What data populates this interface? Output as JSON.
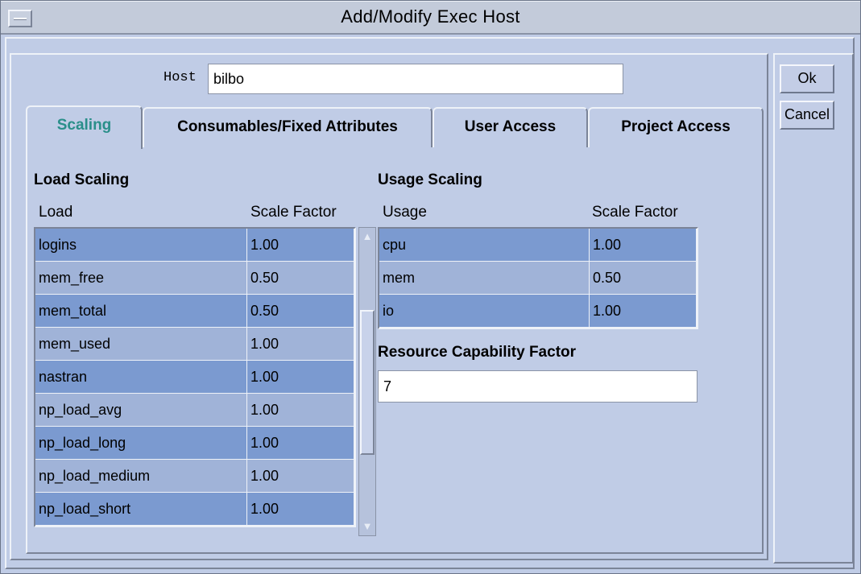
{
  "window": {
    "title": "Add/Modify Exec Host"
  },
  "host": {
    "label": "Host",
    "value": "bilbo"
  },
  "buttons": {
    "ok": "Ok",
    "cancel": "Cancel"
  },
  "tabs": [
    {
      "label": "Scaling",
      "active": true
    },
    {
      "label": "Consumables/Fixed Attributes",
      "active": false
    },
    {
      "label": "User Access",
      "active": false
    },
    {
      "label": "Project Access",
      "active": false
    }
  ],
  "load_scaling": {
    "title": "Load Scaling",
    "col_load": "Load",
    "col_factor": "Scale Factor",
    "rows": [
      {
        "load": "logins",
        "factor": "1.00"
      },
      {
        "load": "mem_free",
        "factor": "0.50"
      },
      {
        "load": "mem_total",
        "factor": "0.50"
      },
      {
        "load": "mem_used",
        "factor": "1.00"
      },
      {
        "load": "nastran",
        "factor": "1.00"
      },
      {
        "load": "np_load_avg",
        "factor": "1.00"
      },
      {
        "load": "np_load_long",
        "factor": "1.00"
      },
      {
        "load": "np_load_medium",
        "factor": "1.00"
      },
      {
        "load": "np_load_short",
        "factor": "1.00"
      }
    ]
  },
  "usage_scaling": {
    "title": "Usage Scaling",
    "col_usage": "Usage",
    "col_factor": "Scale Factor",
    "rows": [
      {
        "usage": "cpu",
        "factor": "1.00"
      },
      {
        "usage": "mem",
        "factor": "0.50"
      },
      {
        "usage": "io",
        "factor": "1.00"
      }
    ]
  },
  "resource_capability": {
    "label": "Resource Capability Factor",
    "value": "7"
  },
  "colors": {
    "active_tab": "#2a8f8a",
    "row_dark": "#7b9ad0",
    "row_light": "#a0b3d8",
    "background": "#c0cce6"
  }
}
